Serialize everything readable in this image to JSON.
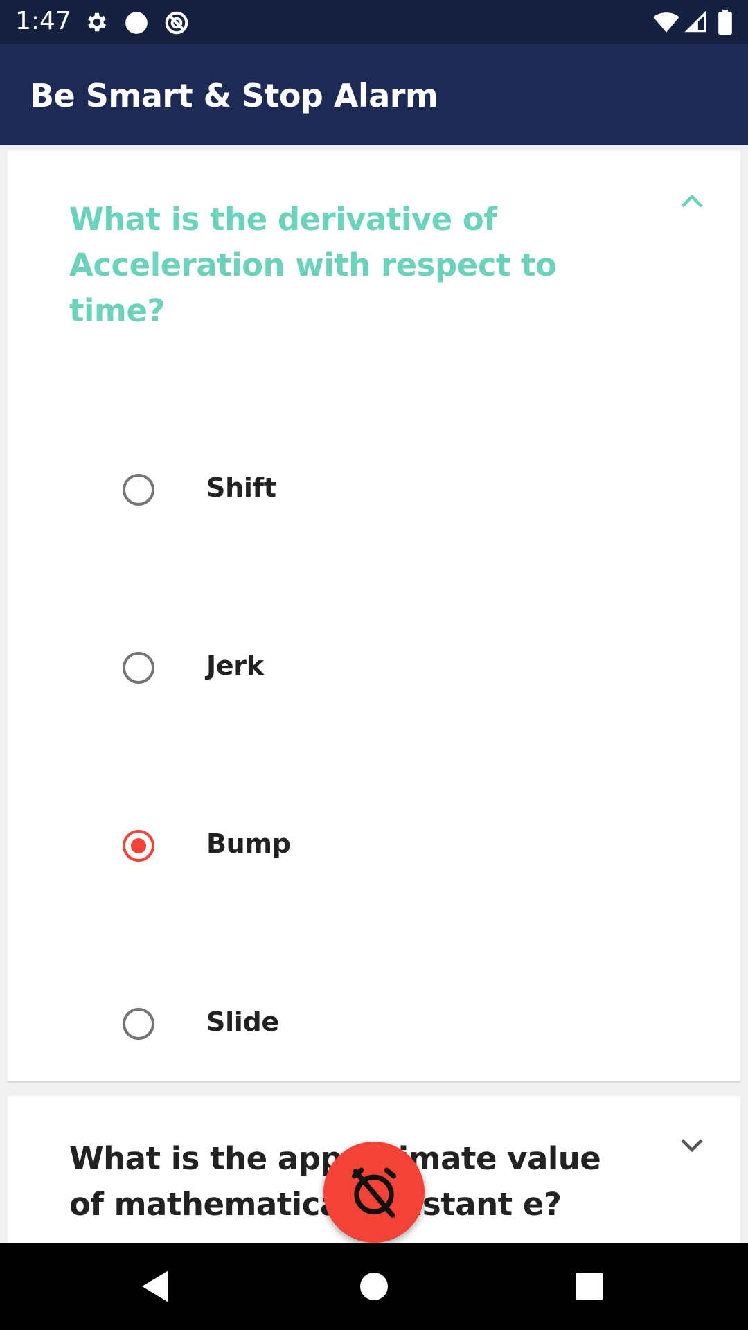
{
  "status_bar": {
    "time": "1:47",
    "icons": [
      "settings-icon",
      "circle-icon",
      "no-tracking-icon",
      "wifi-icon",
      "signal-icon",
      "battery-icon"
    ]
  },
  "app_bar": {
    "title": "Be Smart & Stop Alarm",
    "background": "#1c2a55"
  },
  "questions": [
    {
      "text": "What is the derivative of Acceleration with respect to time?",
      "expanded": true,
      "color": "#6bd2bb",
      "options": [
        {
          "label": "Shift",
          "selected": false
        },
        {
          "label": "Jerk",
          "selected": false
        },
        {
          "label": "Bump",
          "selected": true
        },
        {
          "label": "Slide",
          "selected": false
        }
      ]
    },
    {
      "text": "What is the approximate value of mathematical constant e?",
      "expanded": false,
      "color": "#222222"
    }
  ],
  "fab": {
    "icon": "alarm-off-icon",
    "color": "#f44336"
  },
  "nav_bar": {
    "buttons": [
      "back-icon",
      "home-icon",
      "recents-icon"
    ]
  }
}
